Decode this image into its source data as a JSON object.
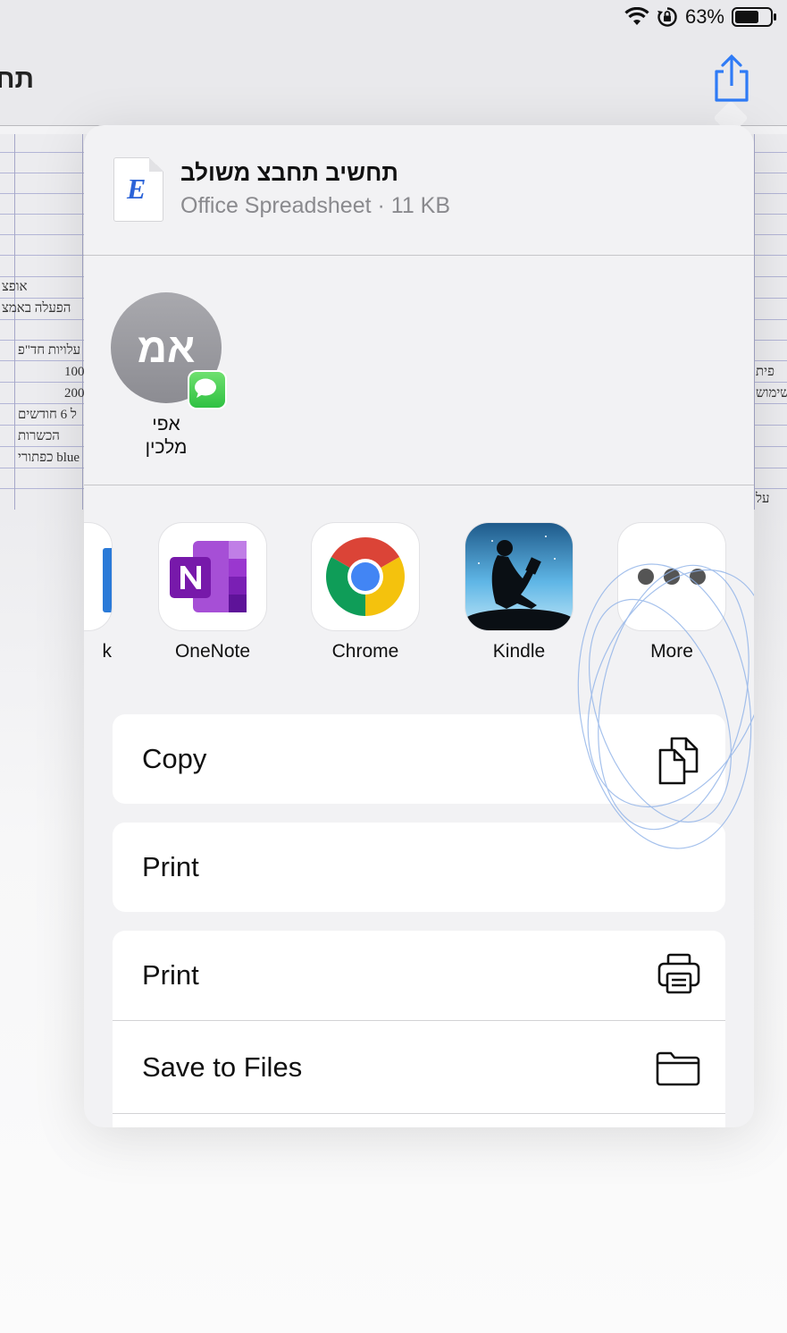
{
  "status_bar": {
    "battery": "63%"
  },
  "background": {
    "title_fragment": "תח",
    "cells": [
      "אופצ",
      "הפעלה באמצ",
      "עלויות חד\"פ",
      "100",
      "200",
      "ל 6 חודשים",
      "הכשרות",
      "כפתורי blue",
      "פית",
      "שימוש",
      "על"
    ]
  },
  "file": {
    "icon_letter": "E",
    "name": "תחשיב תחבצ משולב",
    "meta": "Office Spreadsheet · 11 KB"
  },
  "person": {
    "initials": "אמ",
    "name_line1": "אפי",
    "name_line2": "מלכין"
  },
  "apps": [
    {
      "label": "k"
    },
    {
      "label": "OneNote"
    },
    {
      "label": "Chrome"
    },
    {
      "label": "Kindle"
    },
    {
      "label": "More"
    }
  ],
  "actions": {
    "copy": "Copy",
    "print_plain": "Print",
    "print": "Print",
    "save_to_files": "Save to Files"
  },
  "colors": {
    "accent": "#2f7bf6",
    "sheet": "#f2f2f4",
    "onenote": "#7719aa"
  }
}
